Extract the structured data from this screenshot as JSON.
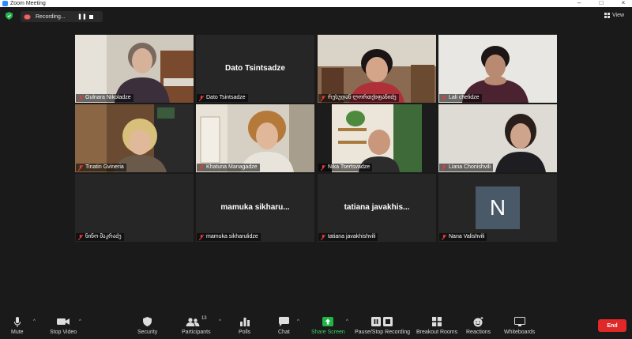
{
  "window": {
    "title": "Zoom Meeting"
  },
  "recording": {
    "label": "Recording...",
    "pause_glyph": "❚❚"
  },
  "view_button": {
    "label": "View"
  },
  "participants": [
    {
      "name": "Gulnara Nikoladze",
      "video": true,
      "muted": true
    },
    {
      "name": "Dato Tsintsadze",
      "video": false,
      "muted": true,
      "center_label": "Dato Tsintsadze"
    },
    {
      "name": "რუსუდან ლორთქიფანიძე",
      "video": true,
      "muted": true
    },
    {
      "name": "Lali chelidze",
      "video": true,
      "muted": true
    },
    {
      "name": "Tinatin Gvineria",
      "video": true,
      "muted": true
    },
    {
      "name": "Khatuna Managadze",
      "video": true,
      "muted": true
    },
    {
      "name": "Nika Tsertsvadze",
      "video": true,
      "muted": true
    },
    {
      "name": "Liana Chonishvili",
      "video": true,
      "muted": true
    },
    {
      "name": "ნინო მაკრაძე",
      "video": false,
      "muted": true
    },
    {
      "name": "mamuka sikharulidze",
      "video": false,
      "muted": true,
      "center_label": "mamuka  sikharu..."
    },
    {
      "name": "tatiana javakhishvili",
      "video": false,
      "muted": true,
      "center_label": "tatiana  javakhis..."
    },
    {
      "name": "Nana Valishvili",
      "video": false,
      "muted": true,
      "avatar_letter": "N"
    }
  ],
  "toolbar": {
    "mute": "Mute",
    "stop_video": "Stop Video",
    "security": "Security",
    "participants": "Participants",
    "participants_count": "13",
    "polls": "Polls",
    "chat": "Chat",
    "share_screen": "Share Screen",
    "pause_stop_recording": "Pause/Stop Recording",
    "breakout_rooms": "Breakout Rooms",
    "reactions": "Reactions",
    "whiteboards": "Whiteboards",
    "end": "End"
  },
  "colors": {
    "background": "#1a1a1a",
    "tile": "#232323",
    "end_button": "#e02828",
    "share_green": "#1fb545",
    "muted_red": "#e53b3b",
    "zoom_blue": "#2d8cff"
  }
}
